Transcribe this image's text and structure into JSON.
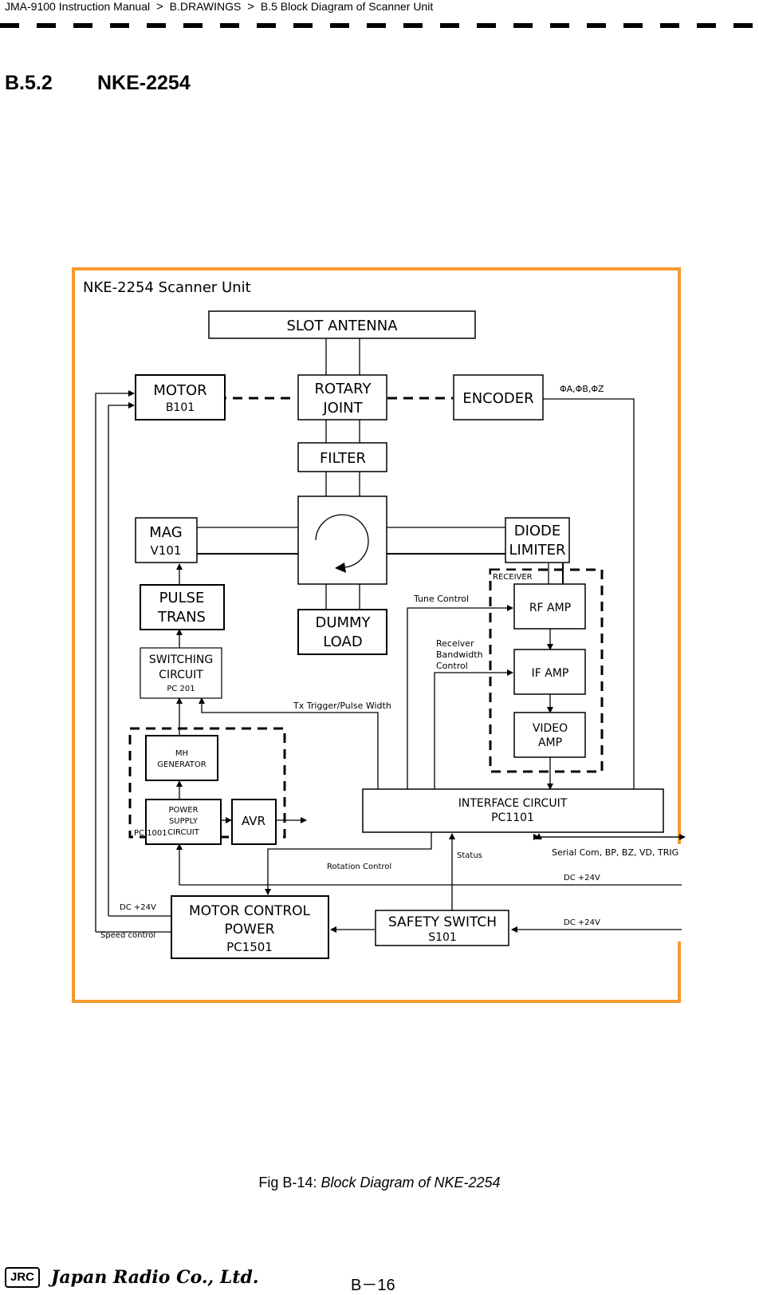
{
  "header": {
    "breadcrumb": [
      "JMA-9100 Instruction Manual",
      "B.DRAWINGS",
      "B.5  Block Diagram of Scanner Unit"
    ],
    "separator": ">"
  },
  "section": {
    "number": "B.5.2",
    "title": "NKE-2254"
  },
  "diagram": {
    "frame_title": "NKE-2254 Scanner Unit",
    "frame_color": "#f59a2e",
    "blocks": {
      "slot_antenna": [
        "SLOT ANTENNA"
      ],
      "motor": [
        "MOTOR",
        "B101"
      ],
      "rotary_joint": [
        "ROTARY",
        "JOINT"
      ],
      "encoder": [
        "ENCODER"
      ],
      "filter": [
        "FILTER"
      ],
      "mag": [
        "MAG",
        "V101"
      ],
      "diode_limiter": [
        "DIODE",
        "LIMITER"
      ],
      "pulse_trans": [
        "PULSE",
        "TRANS"
      ],
      "dummy_load": [
        "DUMMY",
        "LOAD"
      ],
      "switching_circuit": [
        "SWITCHING",
        "CIRCUIT",
        "PC 201"
      ],
      "rf_amp": [
        "RF AMP"
      ],
      "if_amp": [
        "IF AMP"
      ],
      "video_amp": [
        "VIDEO",
        "AMP"
      ],
      "mh_generator": [
        "MH",
        "GENERATOR"
      ],
      "power_supply": [
        "POWER",
        "SUPPLY",
        "CIRCUIT"
      ],
      "avr": [
        "AVR"
      ],
      "interface_circuit": [
        "INTERFACE CIRCUIT",
        "PC1101"
      ],
      "motor_control": [
        "MOTOR CONTROL",
        "POWER",
        "PC1501"
      ],
      "safety_switch": [
        "SAFETY SWITCH",
        "S101"
      ]
    },
    "groups": {
      "receiver": "RECEIVER",
      "pc1001": "PC 1001"
    },
    "signals": {
      "encoder_out": "ΦA,ΦB,ΦZ",
      "tune_control": "Tune Control",
      "receiver_bw": [
        "Receiver",
        "Bandwidth",
        "Control"
      ],
      "tx_trigger": "Tx Trigger/Pulse Width",
      "status": "Status",
      "serial": "Serial Com, BP, BZ, VD, TRIG",
      "rotation_control": "Rotation Control",
      "dc1": "DC +24V",
      "dc_motor": "DC +24V",
      "dc2": "DC +24V",
      "speed_control": "Speed control"
    }
  },
  "caption": {
    "prefix": "Fig B-14: ",
    "text": "Block Diagram of NKE-2254"
  },
  "footer": {
    "logo": "JRC",
    "company": "Japan Radio Co., Ltd.",
    "page": "B－16"
  }
}
